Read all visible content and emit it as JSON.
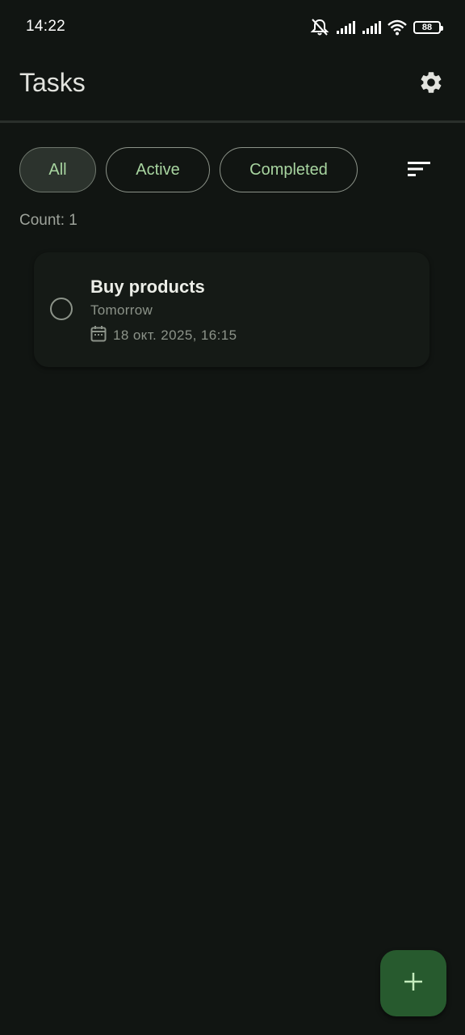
{
  "status_bar": {
    "time": "14:22",
    "battery": "88",
    "icons": [
      "mute-icon",
      "signal-icon",
      "signal-icon",
      "wifi-icon",
      "battery-icon"
    ]
  },
  "app_bar": {
    "title": "Tasks",
    "settings_icon": "gear-icon"
  },
  "filters": {
    "chips": [
      {
        "label": "All",
        "selected": true
      },
      {
        "label": "Active",
        "selected": false
      },
      {
        "label": "Completed",
        "selected": false
      }
    ],
    "sort_icon": "sort-icon"
  },
  "count_label": "Count: 1",
  "tasks": [
    {
      "title": "Buy products",
      "subtitle": "Tomorrow",
      "date": "18 окт. 2025, 16:15",
      "completed": false
    }
  ],
  "fab": {
    "icon": "plus-icon"
  },
  "colors": {
    "background": "#111512",
    "accent": "#a8d5a0",
    "fab_background": "#275a2e",
    "chip_selected": "#2c332d",
    "muted_text": "#8c9389"
  }
}
